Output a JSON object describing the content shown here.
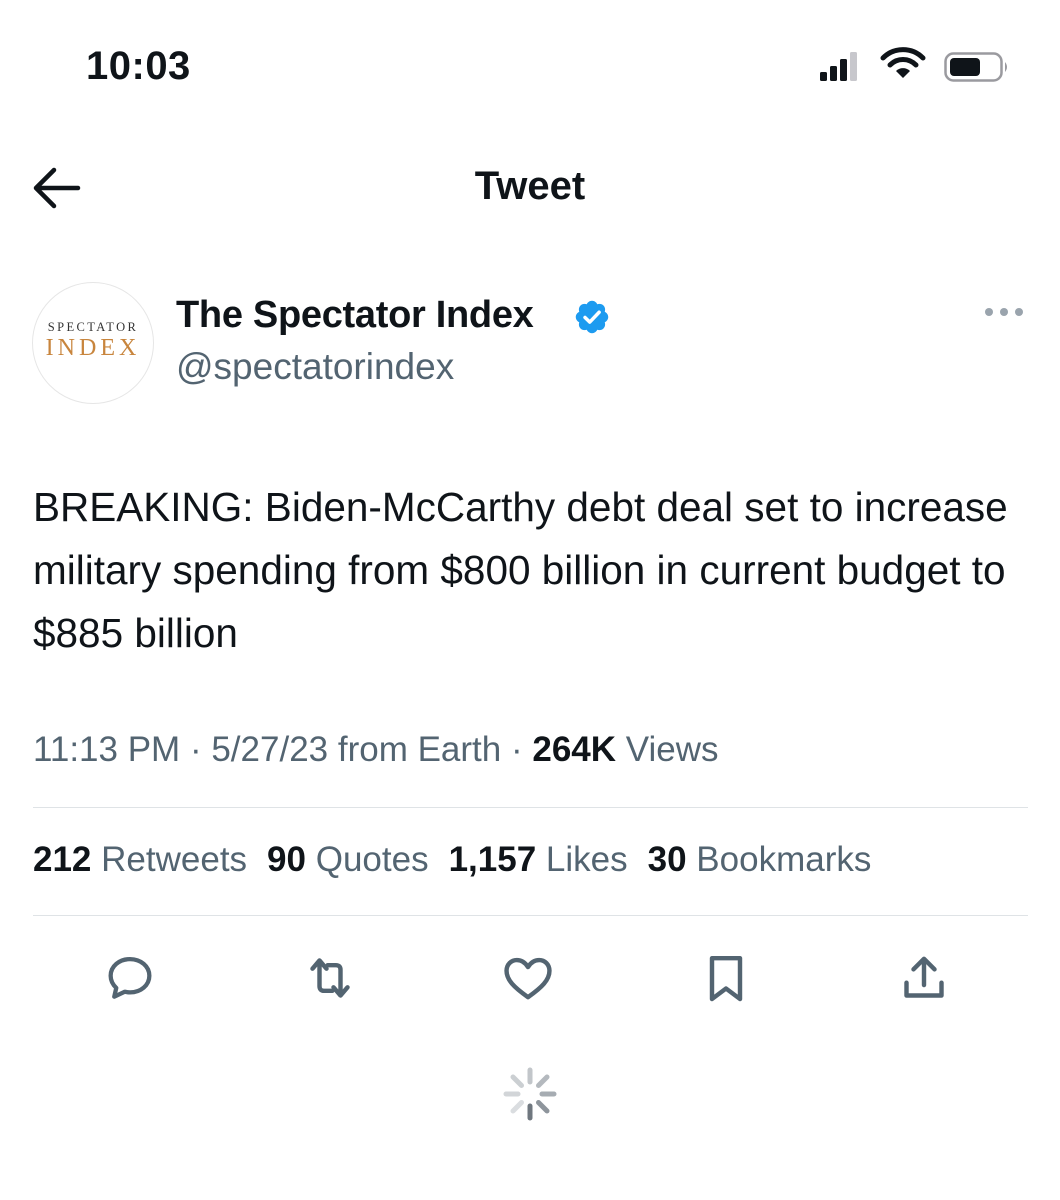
{
  "status_bar": {
    "time": "10:03"
  },
  "header": {
    "title": "Tweet"
  },
  "author": {
    "name": "The Spectator Index",
    "handle": "@spectatorindex",
    "avatar_line1": "SPECTATOR",
    "avatar_line2": "INDEX",
    "verified": true
  },
  "tweet": {
    "text": "BREAKING: Biden-McCarthy debt deal set to increase military spending from $800 billion in current budget to $885 billion",
    "time": "11:13 PM",
    "date": "5/27/23",
    "source": "from Earth",
    "views_count": "264K",
    "views_label": "Views",
    "separator": "·"
  },
  "stats": [
    {
      "count": "212",
      "label": "Retweets"
    },
    {
      "count": "90",
      "label": "Quotes"
    },
    {
      "count": "1,157",
      "label": "Likes"
    },
    {
      "count": "30",
      "label": "Bookmarks"
    }
  ],
  "actions": [
    "reply-icon",
    "retweet-icon",
    "like-icon",
    "bookmark-icon",
    "share-icon"
  ],
  "colors": {
    "verified": "#1d9bf0",
    "secondary_text": "#536471",
    "primary_text": "#0f1419",
    "avatar_accent": "#c8853d"
  }
}
